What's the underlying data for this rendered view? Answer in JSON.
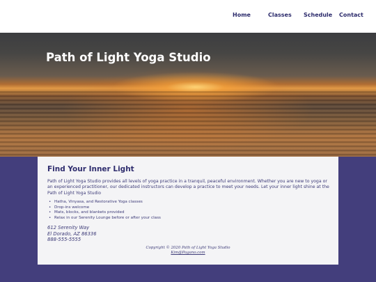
{
  "nav": {
    "items": [
      "Home",
      "Classes",
      "Schedule",
      "Contact"
    ]
  },
  "hero": {
    "title": "Path of Light Yoga Studio"
  },
  "content": {
    "heading": "Find Your Inner Light",
    "intro": "Path of Light Yoga Studio provides all levels of yoga practice in a tranquil, peaceful environment. Whether you are new to yoga or an experienced practitioner, our dedicated instructors can develop a practice to meet your needs. Let your inner light shine at the Path of Light Yoga Studio",
    "features": [
      "Hatha, Vinyasa, and Restorative Yoga classes",
      "Drop-ins welcome",
      "Mats, blocks, and blankets provided",
      "Relax in our Serenity Lounge before or after your class"
    ],
    "address": {
      "street": "612 Serenity Way",
      "city": "El Dorado, AZ 86336",
      "phone": "888-555-5555"
    }
  },
  "footer": {
    "copyright": "Copyright © 2020 Path of Light Yoga Studio",
    "email": "Kim@Pagano.com"
  },
  "colors": {
    "page_background": "#433e7c",
    "text": "#3d3b78",
    "nav_text": "#2b2a6b",
    "card_background": "#f4f4f6"
  }
}
